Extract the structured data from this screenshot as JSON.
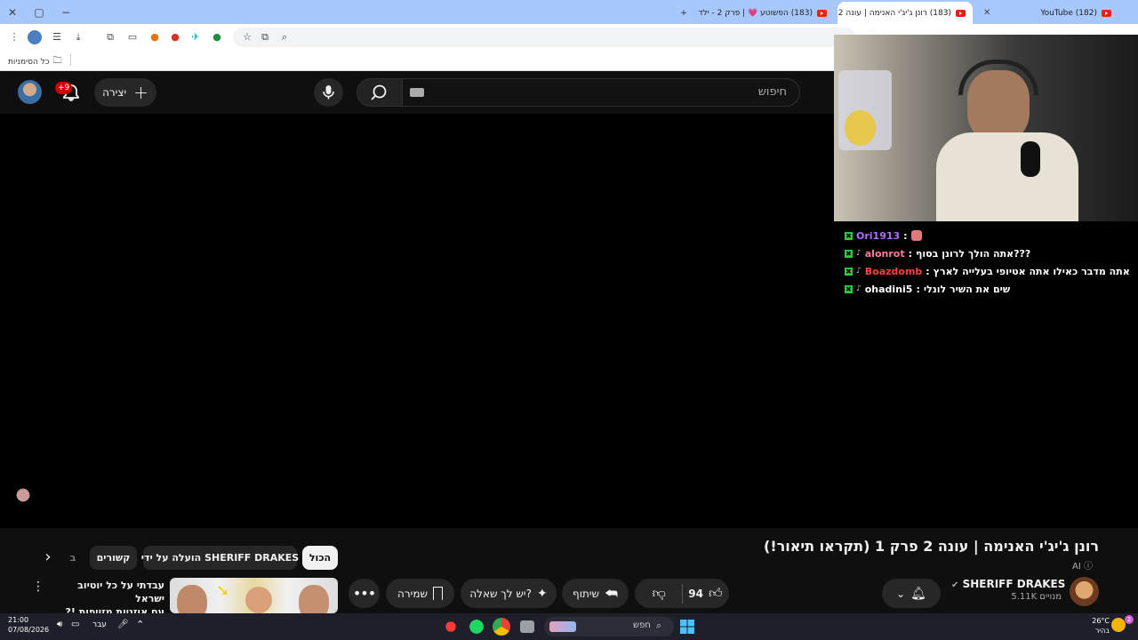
{
  "browser": {
    "tabs": [
      {
        "title": "(182) YouTube",
        "active": false
      },
      {
        "title": "(183) רונן ג'יג'י האנימה | עונה 2",
        "active": true
      },
      {
        "title": "(183) הפשוטע 💗 | פרק 2 - ילד",
        "active": false
      }
    ],
    "new_tab": "+",
    "bookmarks_label": "כל הסימניות"
  },
  "youtube": {
    "search_placeholder": "חיפוש",
    "create_label": "יצירה",
    "notifications_count": "+9"
  },
  "chat": [
    {
      "user": "Ori1913",
      "user_color": "#b36bff",
      "message": ""
    },
    {
      "user": "alonrot",
      "user_color": "#ff7a9c",
      "message": "???אתה הולך לרונן בסוף"
    },
    {
      "user": "Boazdomb",
      "user_color": "#ff4040",
      "message": "אתה מדבר כאילו אתה אטיופי בעלייה לארץ"
    },
    {
      "user": "ohadini5",
      "user_color": "#ffffff",
      "message": "שים את השיר לונלי"
    }
  ],
  "video": {
    "title": "רונן ג'יג'י האנימה | עונה 2 פרק 1 (תקראו תיאור!)",
    "ai_badge": "AI",
    "channel_name": "SHERIFF DRAKES",
    "subscribers": "5.11K מנויים",
    "likes": "94",
    "share_label": "שיתוף",
    "ask_label": "יש לך שאלה?",
    "save_label": "שמירה"
  },
  "chips": {
    "all": "הכול",
    "uploaded_by": "הועלה על ידי SHERIFF DRAKES",
    "related": "קשורים",
    "partial": "ב"
  },
  "recommended": {
    "title_line1": "עבדתי על כל יוטיוב ישראל",
    "title_line2": "עם אוזניות מזויפות !? ..."
  },
  "taskbar": {
    "time": "21:00",
    "date": "07/08/2026",
    "lang": "עבר",
    "search_label": "חפש",
    "weather_temp": "26°C",
    "weather_desc": "בהיר",
    "weather_badge": "2"
  }
}
